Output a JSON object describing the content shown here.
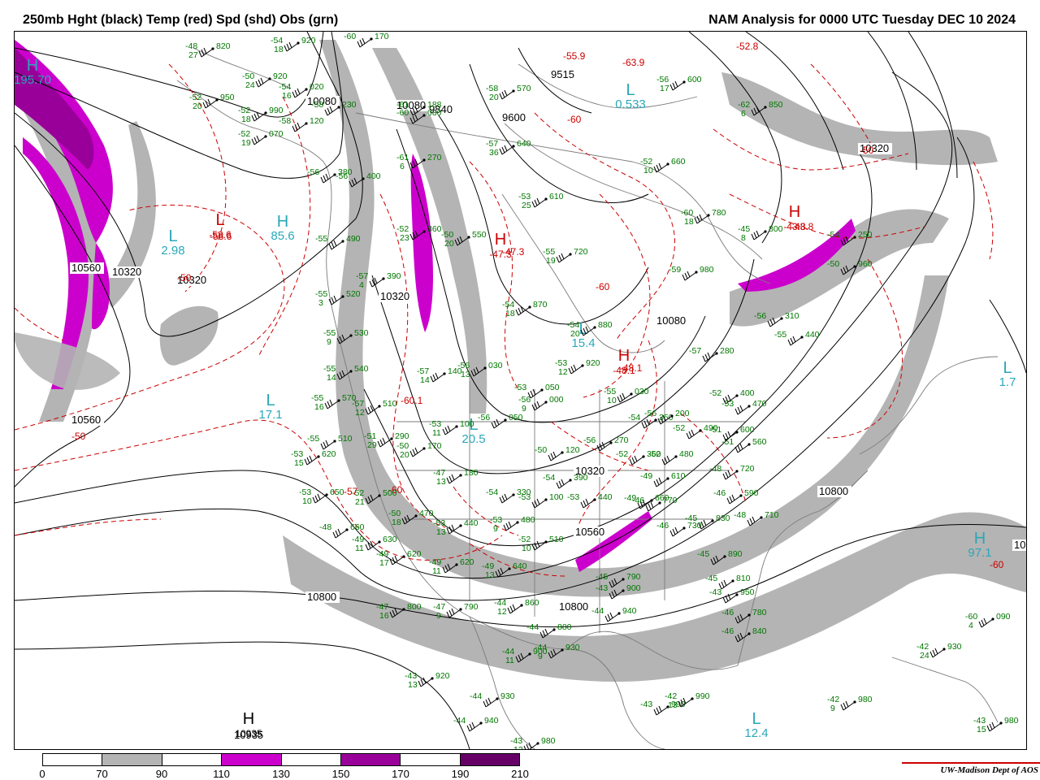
{
  "header": {
    "title_left": "250mb Hght (black) Temp (red) Spd (shd) Obs (grn)",
    "title_right": "NAM Analysis for 0000 UTC Tuesday  DEC 10 2024"
  },
  "colors": {
    "height_contour": "#000000",
    "temperature_contour": "#cc0000",
    "observations": "#007700",
    "center_labels_cyan": "#2aa7b9",
    "center_labels_red": "#cc0000",
    "geography": "#7a7a7a",
    "shade_70_90": "#b4b4b4",
    "shade_110_130": "#cc00cc",
    "shade_150_170": "#990099",
    "shade_190_210": "#660066"
  },
  "legend": {
    "ticks": [
      "0",
      "70",
      "90",
      "110",
      "130",
      "150",
      "170",
      "190",
      "210"
    ],
    "segments": [
      "#ffffff",
      "#b4b4b4",
      "#ffffff",
      "#cc00cc",
      "#ffffff",
      "#990099",
      "#ffffff",
      "#660066"
    ]
  },
  "credit": "UW-Madison   Dept of AOS",
  "height_labels": [
    "10560",
    "10320",
    "10080",
    "9840",
    "9600",
    "9515",
    "10320",
    "10080",
    "10320",
    "10560",
    "10800",
    "10800",
    "10800",
    "10320",
    "10560",
    "10935",
    "10320",
    "10080",
    "10560"
  ],
  "temp_labels": [
    "-58.6",
    "-50",
    "-50",
    "-47.3",
    "-60",
    "-60",
    "-63.9",
    "-55.9",
    "-52.8",
    "-43.8",
    "-48.1",
    "-60.1",
    "-60",
    "-50",
    "-57",
    "-60"
  ],
  "centers": [
    {
      "type": "H",
      "value": "195.70",
      "color": "cyan"
    },
    {
      "type": "L",
      "value": "2.98",
      "color": "cyan"
    },
    {
      "type": "H",
      "value": "85.6",
      "color": "cyan"
    },
    {
      "type": "L",
      "value": "17.1",
      "color": "cyan"
    },
    {
      "type": "L",
      "value": "20.5",
      "color": "cyan"
    },
    {
      "type": "L",
      "value": "0.533",
      "color": "cyan"
    },
    {
      "type": "L",
      "value": "15.4",
      "color": "cyan"
    },
    {
      "type": "L",
      "value": "12.4",
      "color": "cyan"
    },
    {
      "type": "L",
      "value": "1.7",
      "color": "cyan"
    },
    {
      "type": "H",
      "value": "97.1",
      "color": "cyan"
    },
    {
      "type": "L",
      "value": "-58.6",
      "color": "red"
    },
    {
      "type": "H",
      "value": "-47.3",
      "color": "red"
    },
    {
      "type": "H",
      "value": "-43.8",
      "color": "red"
    },
    {
      "type": "H",
      "value": "-48.1",
      "color": "red"
    },
    {
      "type": "H",
      "value": "10935",
      "color": "black"
    }
  ],
  "observations": [
    {
      "t": "-48",
      "h": "820",
      "s": "27"
    },
    {
      "t": "-54",
      "h": "920",
      "s": "18"
    },
    {
      "t": "-50",
      "h": "920",
      "s": "24"
    },
    {
      "t": "-54",
      "h": "020",
      "s": "16"
    },
    {
      "t": "-52",
      "h": "950",
      "s": "20"
    },
    {
      "t": "-52",
      "h": "990",
      "s": "18"
    },
    {
      "t": "-52",
      "h": "070",
      "s": "19"
    },
    {
      "t": "-58",
      "h": "120",
      "s": ""
    },
    {
      "t": "-58",
      "h": "230",
      "s": ""
    },
    {
      "t": "-56",
      "h": "380",
      "s": ""
    },
    {
      "t": "-56",
      "h": "400",
      "s": ""
    },
    {
      "t": "-55",
      "h": "490",
      "s": ""
    },
    {
      "t": "-57",
      "h": "390",
      "s": "4"
    },
    {
      "t": "-55",
      "h": "520",
      "s": "3"
    },
    {
      "t": "-55",
      "h": "530",
      "s": "9"
    },
    {
      "t": "-55",
      "h": "540",
      "s": "14"
    },
    {
      "t": "-55",
      "h": "570",
      "s": "16"
    },
    {
      "t": "-55",
      "h": "510",
      "s": ""
    },
    {
      "t": "-57",
      "h": "510",
      "s": "12"
    },
    {
      "t": "-53",
      "h": "620",
      "s": "15"
    },
    {
      "t": "-53",
      "h": "650",
      "s": "10"
    },
    {
      "t": "-51",
      "h": "290",
      "s": "29"
    },
    {
      "t": "-50",
      "h": "170",
      "s": "20"
    },
    {
      "t": "-52",
      "h": "500",
      "s": "21"
    },
    {
      "t": "-57",
      "h": "140",
      "s": "14"
    },
    {
      "t": "-56",
      "h": "030",
      "s": "13"
    },
    {
      "t": "-53",
      "h": "100",
      "s": "11"
    },
    {
      "t": "-56",
      "h": "050",
      "s": ""
    },
    {
      "t": "-47",
      "h": "180",
      "s": "13"
    },
    {
      "t": "-50",
      "h": "470",
      "s": "18"
    },
    {
      "t": "-48",
      "h": "660",
      "s": ""
    },
    {
      "t": "-49",
      "h": "630",
      "s": "11"
    },
    {
      "t": "-49",
      "h": "620",
      "s": "17"
    },
    {
      "t": "-53",
      "h": "440",
      "s": "13"
    },
    {
      "t": "-49",
      "h": "620",
      "s": "11"
    },
    {
      "t": "-47",
      "h": "800",
      "s": "16"
    },
    {
      "t": "-47",
      "h": "790",
      "s": "9"
    },
    {
      "t": "-49",
      "h": "640",
      "s": "13"
    },
    {
      "t": "-54",
      "h": "330",
      "s": ""
    },
    {
      "t": "-53",
      "h": "480",
      "s": "9"
    },
    {
      "t": "-52",
      "h": "510",
      "s": "10"
    },
    {
      "t": "-50",
      "h": "120",
      "s": ""
    },
    {
      "t": "-53",
      "h": "100",
      "s": ""
    },
    {
      "t": "-54",
      "h": "390",
      "s": ""
    },
    {
      "t": "-53",
      "h": "440",
      "s": ""
    },
    {
      "t": "-56",
      "h": "270",
      "s": ""
    },
    {
      "t": "-52",
      "h": "360",
      "s": ""
    },
    {
      "t": "-54",
      "h": "350",
      "s": ""
    },
    {
      "t": "-56",
      "h": "200",
      "s": ""
    },
    {
      "t": "-55",
      "h": "030",
      "s": "10"
    },
    {
      "t": "-53",
      "h": "050",
      "s": ""
    },
    {
      "t": "-56",
      "h": "000",
      "s": "9"
    },
    {
      "t": "-53",
      "h": "920",
      "s": "12"
    },
    {
      "t": "-54",
      "h": "880",
      "s": "20"
    },
    {
      "t": "-55",
      "h": "720",
      "s": "19"
    },
    {
      "t": "-54",
      "h": "870",
      "s": "18"
    },
    {
      "t": "-57",
      "h": "640",
      "s": "36"
    },
    {
      "t": "-53",
      "h": "610",
      "s": "25"
    },
    {
      "t": "-52",
      "h": "660",
      "s": "10"
    },
    {
      "t": "-60",
      "h": "780",
      "s": "18"
    },
    {
      "t": "-58",
      "h": "570",
      "s": "20"
    },
    {
      "t": "-56",
      "h": "600",
      "s": "17"
    },
    {
      "t": "-62",
      "h": "850",
      "s": "6"
    },
    {
      "t": "-45",
      "h": "800",
      "s": "8"
    },
    {
      "t": "-59",
      "h": "980",
      "s": ""
    },
    {
      "t": "-56",
      "h": "310",
      "s": ""
    },
    {
      "t": "-55",
      "h": "440",
      "s": ""
    },
    {
      "t": "-57",
      "h": "280",
      "s": ""
    },
    {
      "t": "-52",
      "h": "400",
      "s": ""
    },
    {
      "t": "-53",
      "h": "470",
      "s": ""
    },
    {
      "t": "-51",
      "h": "560",
      "s": ""
    },
    {
      "t": "-51",
      "h": "600",
      "s": ""
    },
    {
      "t": "-52",
      "h": "490",
      "s": ""
    },
    {
      "t": "-52",
      "h": "480",
      "s": ""
    },
    {
      "t": "-49",
      "h": "610",
      "s": ""
    },
    {
      "t": "-49",
      "h": "660",
      "s": ""
    },
    {
      "t": "-48",
      "h": "720",
      "s": ""
    },
    {
      "t": "-46",
      "h": "590",
      "s": ""
    },
    {
      "t": "-48",
      "h": "710",
      "s": ""
    },
    {
      "t": "-46",
      "h": "770",
      "s": ""
    },
    {
      "t": "-46",
      "h": "730",
      "s": ""
    },
    {
      "t": "-45",
      "h": "830",
      "s": ""
    },
    {
      "t": "-45",
      "h": "890",
      "s": ""
    },
    {
      "t": "-45",
      "h": "810",
      "s": ""
    },
    {
      "t": "-45",
      "h": "790",
      "s": ""
    },
    {
      "t": "-43",
      "h": "900",
      "s": ""
    },
    {
      "t": "-44",
      "h": "940",
      "s": ""
    },
    {
      "t": "-43",
      "h": "950",
      "s": ""
    },
    {
      "t": "-46",
      "h": "780",
      "s": ""
    },
    {
      "t": "-46",
      "h": "840",
      "s": ""
    },
    {
      "t": "-44",
      "h": "860",
      "s": "12"
    },
    {
      "t": "-44",
      "h": "880",
      "s": ""
    },
    {
      "t": "-44",
      "h": "900",
      "s": "11"
    },
    {
      "t": "-44",
      "h": "930",
      "s": "9"
    },
    {
      "t": "-43",
      "h": "920",
      "s": "13"
    },
    {
      "t": "-44",
      "h": "930",
      "s": ""
    },
    {
      "t": "-44",
      "h": "940",
      "s": ""
    },
    {
      "t": "-43",
      "h": "980",
      "s": "12"
    },
    {
      "t": "-43",
      "h": "990",
      "s": ""
    },
    {
      "t": "-42",
      "h": "990",
      "s": "13"
    },
    {
      "t": "-42",
      "h": "980",
      "s": "9"
    },
    {
      "t": "-43",
      "h": "980",
      "s": "15"
    },
    {
      "t": "-42",
      "h": "930",
      "s": "24"
    },
    {
      "t": "-60",
      "h": "090",
      "s": "4"
    },
    {
      "t": "-60",
      "h": "170",
      "s": ""
    },
    {
      "t": "-60",
      "h": "080",
      "s": ""
    },
    {
      "t": "-61",
      "h": "188",
      "s": ""
    },
    {
      "t": "-61",
      "h": "270",
      "s": "6"
    },
    {
      "t": "-52",
      "h": "360",
      "s": "23"
    },
    {
      "t": "-50",
      "h": "550",
      "s": "20"
    },
    {
      "t": "-54",
      "h": "250",
      "s": ""
    },
    {
      "t": "-50",
      "h": "960",
      "s": ""
    }
  ]
}
